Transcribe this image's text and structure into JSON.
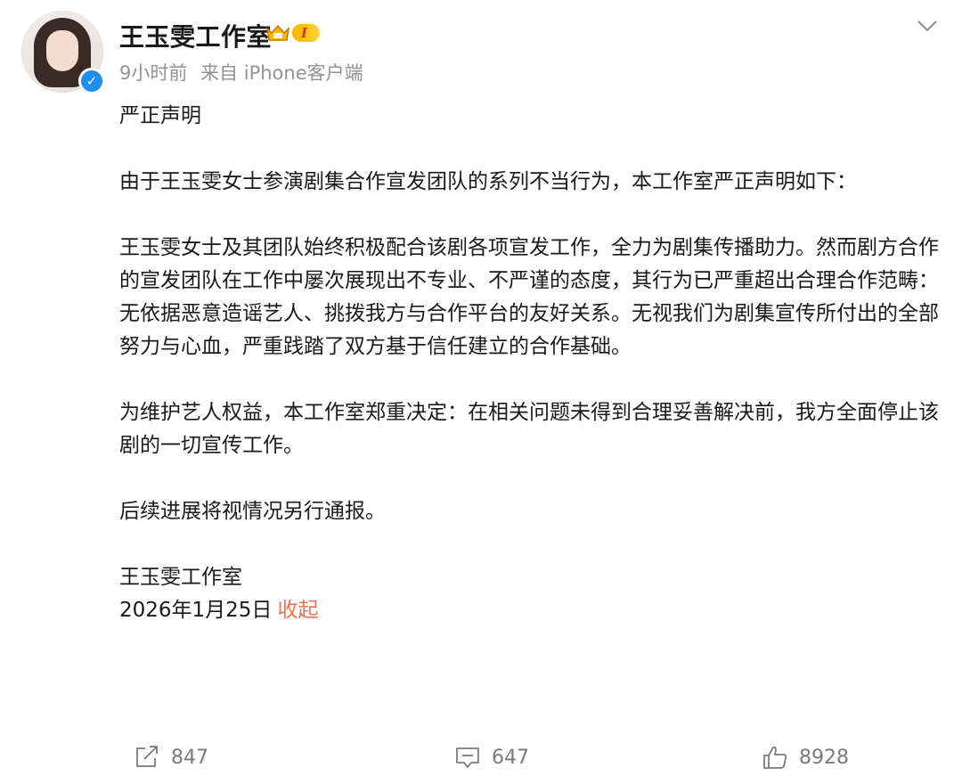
{
  "post": {
    "username": "王玉雯工作室",
    "vip_level": "I",
    "time": "9小时前",
    "source": "来自 iPhone客户端",
    "paragraphs": [
      "严正声明",
      "由于王玉雯女士参演剧集合作宣发团队的系列不当行为，本工作室严正声明如下：",
      "王玉雯女士及其团队始终积极配合该剧各项宣发工作，全力为剧集传播助力。然而剧方合作的宣发团队在工作中屡次展现出不专业、不严谨的态度，其行为已严重超出合理合作范畴：无依据恶意造谣艺人、挑拨我方与合作平台的友好关系。无视我们为剧集宣传所付出的全部努力与心血，严重践踏了双方基于信任建立的合作基础。",
      "为维护艺人权益，本工作室郑重决定：在相关问题未得到合理妥善解决前，我方全面停止该剧的一切宣传工作。",
      "后续进展将视情况另行通报。"
    ],
    "signature": "王玉雯工作室",
    "date": "2026年1月25日",
    "collapse_label": "收起"
  },
  "actions": {
    "share_count": "847",
    "comment_count": "647",
    "like_count": "8928"
  },
  "colors": {
    "accent": "#eb7350",
    "verified": "#1f8eea",
    "meta": "#939393"
  }
}
